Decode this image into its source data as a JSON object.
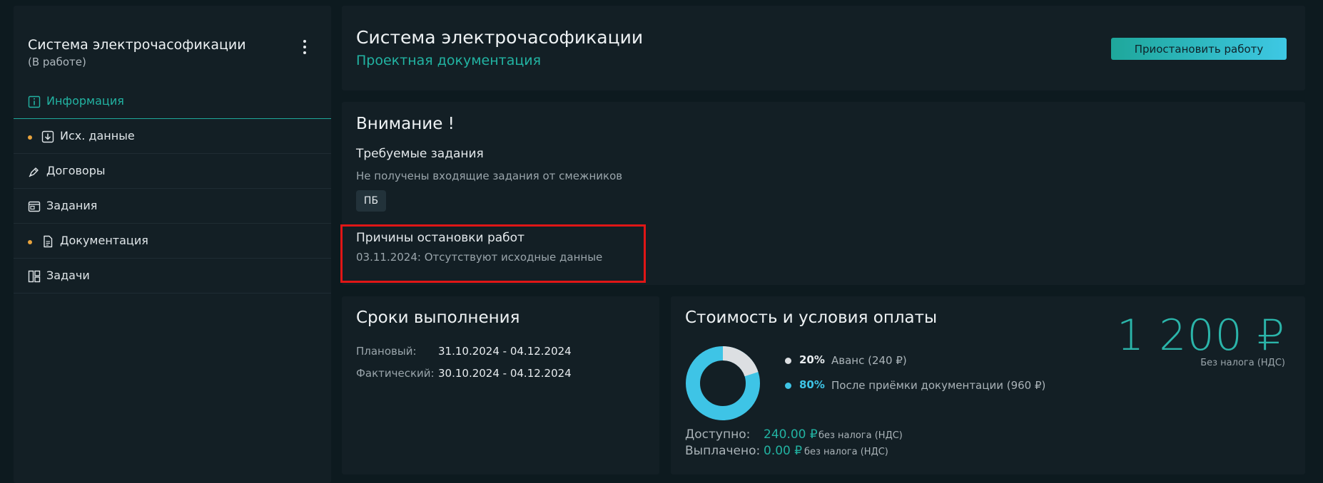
{
  "sidebar": {
    "title": "Система электрочасофикации",
    "status": "(В работе)",
    "items": [
      {
        "label": "Информация",
        "icon": "info-icon",
        "active": true,
        "dot": false
      },
      {
        "label": "Исх. данные",
        "icon": "download-icon",
        "active": false,
        "dot": true
      },
      {
        "label": "Договоры",
        "icon": "pen-icon",
        "active": false,
        "dot": false
      },
      {
        "label": "Задания",
        "icon": "window-icon",
        "active": false,
        "dot": false
      },
      {
        "label": "Документация",
        "icon": "document-icon",
        "active": false,
        "dot": true
      },
      {
        "label": "Задачи",
        "icon": "layout-icon",
        "active": false,
        "dot": false
      }
    ]
  },
  "header": {
    "title": "Система электрочасофикации",
    "subtitle": "Проектная документация",
    "pause_button": "Приостановить работу"
  },
  "attention": {
    "title": "Внимание !",
    "required_title": "Требуемые задания",
    "required_message": "Не получены входящие задания от смежников",
    "chip": "ПБ",
    "stop_title": "Причины остановки работ",
    "stop_text": "03.11.2024: Отсутствуют исходные данные"
  },
  "deadlines": {
    "title": "Сроки выполнения",
    "planned_label": "Плановый:",
    "planned_value": "31.10.2024 - 04.12.2024",
    "actual_label": "Фактический:",
    "actual_value": "30.10.2024 - 04.12.2024"
  },
  "payment": {
    "title": "Стоимость и условия оплаты",
    "amount": "1 200 ₽",
    "amount_note": "Без налога (НДС)",
    "legend": [
      {
        "pct": "20%",
        "text": "Аванс (240 ₽)",
        "color": "#dcdfe2"
      },
      {
        "pct": "80%",
        "text": "После приёмки документации (960 ₽)",
        "color": "#3ec4e6"
      }
    ],
    "available_label": "Доступно:",
    "available_value": "240.00 ₽",
    "available_note": "без налога (НДС)",
    "paid_label": "Выплачено:",
    "paid_value": "0.00 ₽",
    "paid_note": "без налога (НДС)"
  },
  "colors": {
    "accent": "#22b3a2",
    "advance_slice": "#dcdfe2",
    "after_slice": "#3ec4e6",
    "highlight_border": "#e01616",
    "status_dot": "#e8a33d"
  }
}
